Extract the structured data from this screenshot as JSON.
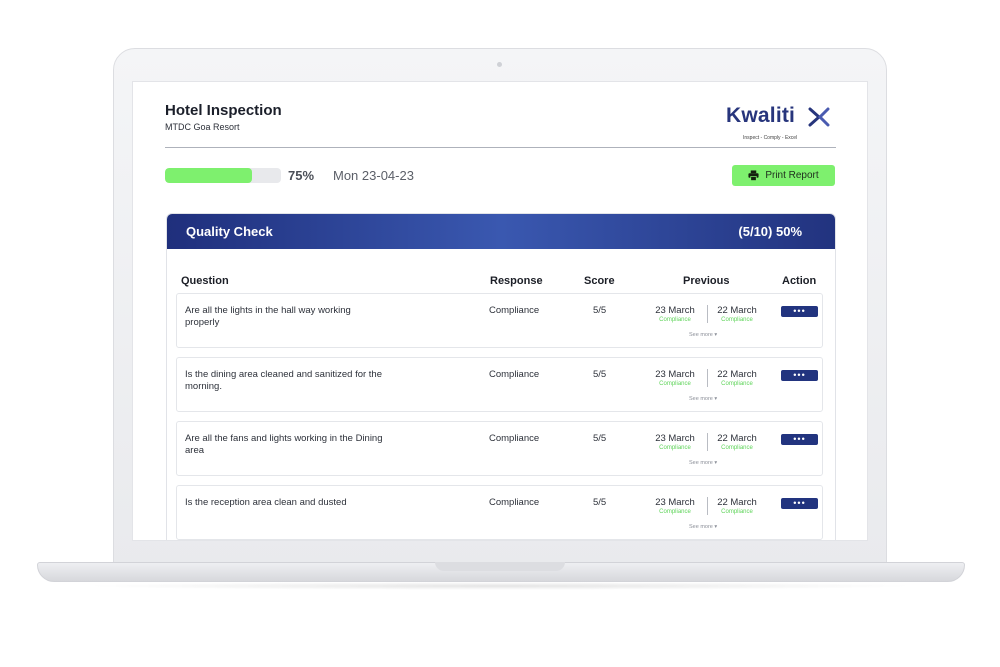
{
  "header": {
    "title": "Hotel Inspection",
    "subtitle": "MTDC Goa Resort"
  },
  "logo": {
    "word": "Kwaliti",
    "tagline": "Inspect - Comply - Excel",
    "color": "#27357c"
  },
  "progress": {
    "percent_label": "75%",
    "fraction": 0.75,
    "date": "Mon 23-04-23",
    "color": "#7ef06e"
  },
  "print_button": {
    "label": "Print Report",
    "icon": "printer-icon"
  },
  "section": {
    "title": "Quality Check",
    "summary": "(5/10) 50%"
  },
  "columns": {
    "question": "Question",
    "response": "Response",
    "score": "Score",
    "previous": "Previous",
    "action": "Action"
  },
  "rows": [
    {
      "question": "Are all the lights in the hall way working properly",
      "response": "Compliance",
      "score": "5/5",
      "prev1_date": "23 March",
      "prev1_status": "Compliance",
      "prev2_date": "22 March",
      "prev2_status": "Compliance",
      "see_more": "See more ▾",
      "action": "•••"
    },
    {
      "question": "Is the dining area cleaned and sanitized for the morning.",
      "response": "Compliance",
      "score": "5/5",
      "prev1_date": "23 March",
      "prev1_status": "Compliance",
      "prev2_date": "22 March",
      "prev2_status": "Compliance",
      "see_more": "See more ▾",
      "action": "•••"
    },
    {
      "question": "Are all the fans and lights working in the Dining area",
      "response": "Compliance",
      "score": "5/5",
      "prev1_date": "23 March",
      "prev1_status": "Compliance",
      "prev2_date": "22 March",
      "prev2_status": "Compliance",
      "see_more": "See more ▾",
      "action": "•••"
    },
    {
      "question": "Is the reception area clean and dusted",
      "response": "Compliance",
      "score": "5/5",
      "prev1_date": "23 March",
      "prev1_status": "Compliance",
      "prev2_date": "22 March",
      "prev2_status": "Compliance",
      "see_more": "See more ▾",
      "action": "•••"
    }
  ]
}
